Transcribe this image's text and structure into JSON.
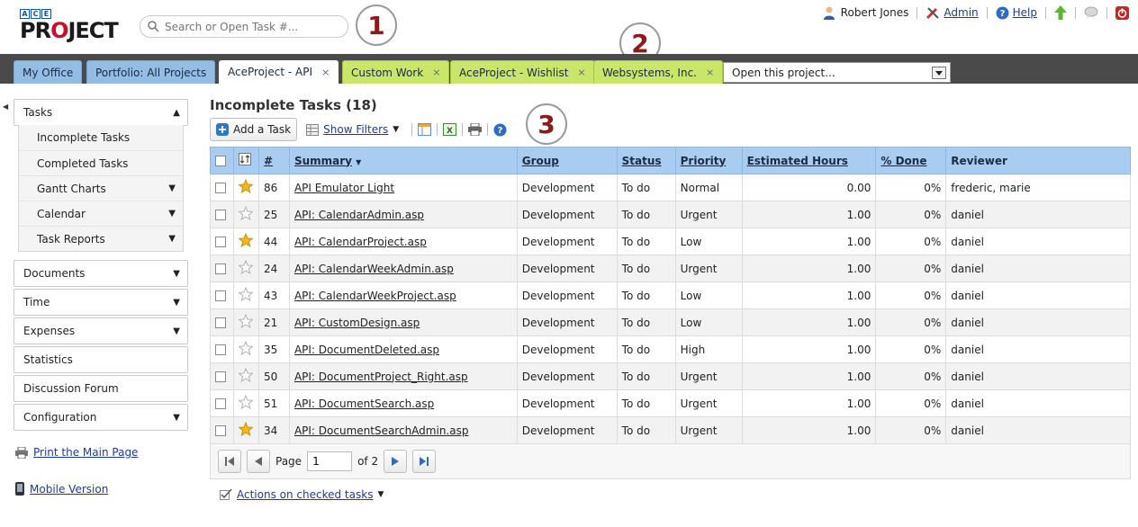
{
  "header": {
    "logo_top": "ACE",
    "logo_bottom": "PROJECT",
    "search_placeholder": "Search or Open Task #...",
    "user_name": "Robert Jones",
    "admin_label": "Admin",
    "help_label": "Help"
  },
  "callouts": [
    "1",
    "2",
    "3"
  ],
  "tabs": [
    {
      "label": "My Office",
      "style": "blue",
      "closable": false
    },
    {
      "label": "Portfolio: All Projects",
      "style": "blue",
      "closable": false
    },
    {
      "label": "AceProject - API",
      "style": "active",
      "closable": true
    },
    {
      "label": "Custom Work",
      "style": "green",
      "closable": true
    },
    {
      "label": "AceProject - Wishlist",
      "style": "green",
      "closable": true
    },
    {
      "label": "Websystems, Inc.",
      "style": "green",
      "closable": true
    }
  ],
  "tab_close_glyph": "×",
  "project_select": "Open this project...",
  "sidebar": {
    "tasks_label": "Tasks",
    "task_items": [
      {
        "label": "Incomplete Tasks",
        "expand": false
      },
      {
        "label": "Completed Tasks",
        "expand": false
      },
      {
        "label": "Gantt Charts",
        "expand": true
      },
      {
        "label": "Calendar",
        "expand": true
      },
      {
        "label": "Task Reports",
        "expand": true
      }
    ],
    "sections": [
      {
        "label": "Documents",
        "expand": true
      },
      {
        "label": "Time",
        "expand": true
      },
      {
        "label": "Expenses",
        "expand": true
      },
      {
        "label": "Statistics",
        "expand": false
      },
      {
        "label": "Discussion Forum",
        "expand": false
      },
      {
        "label": "Configuration",
        "expand": true
      }
    ],
    "print_link": "Print the Main Page",
    "mobile_link": "Mobile Version"
  },
  "main": {
    "title": "Incomplete Tasks (18)",
    "add_task": "Add a Task",
    "show_filters": "Show Filters",
    "columns": [
      "#",
      "Summary",
      "Group",
      "Status",
      "Priority",
      "Estimated Hours",
      "% Done",
      "Reviewer"
    ],
    "rows": [
      {
        "starred": true,
        "id": "86",
        "summary": "API Emulator Light",
        "group": "Development",
        "status": "To do",
        "priority": "Normal",
        "hours": "0.00",
        "done": "0%",
        "reviewer": "frederic, marie"
      },
      {
        "starred": false,
        "id": "25",
        "summary": "API: CalendarAdmin.asp",
        "group": "Development",
        "status": "To do",
        "priority": "Urgent",
        "hours": "1.00",
        "done": "0%",
        "reviewer": "daniel"
      },
      {
        "starred": true,
        "id": "44",
        "summary": "API: CalendarProject.asp",
        "group": "Development",
        "status": "To do",
        "priority": "Low",
        "hours": "1.00",
        "done": "0%",
        "reviewer": "daniel"
      },
      {
        "starred": false,
        "id": "24",
        "summary": "API: CalendarWeekAdmin.asp",
        "group": "Development",
        "status": "To do",
        "priority": "Urgent",
        "hours": "1.00",
        "done": "0%",
        "reviewer": "daniel"
      },
      {
        "starred": false,
        "id": "43",
        "summary": "API: CalendarWeekProject.asp",
        "group": "Development",
        "status": "To do",
        "priority": "Low",
        "hours": "1.00",
        "done": "0%",
        "reviewer": "daniel"
      },
      {
        "starred": false,
        "id": "21",
        "summary": "API: CustomDesign.asp",
        "group": "Development",
        "status": "To do",
        "priority": "Low",
        "hours": "1.00",
        "done": "0%",
        "reviewer": "daniel"
      },
      {
        "starred": false,
        "id": "35",
        "summary": "API: DocumentDeleted.asp",
        "group": "Development",
        "status": "To do",
        "priority": "High",
        "hours": "1.00",
        "done": "0%",
        "reviewer": "daniel"
      },
      {
        "starred": false,
        "id": "50",
        "summary": "API: DocumentProject_Right.asp",
        "group": "Development",
        "status": "To do",
        "priority": "Urgent",
        "hours": "1.00",
        "done": "0%",
        "reviewer": "daniel"
      },
      {
        "starred": false,
        "id": "51",
        "summary": "API: DocumentSearch.asp",
        "group": "Development",
        "status": "To do",
        "priority": "Urgent",
        "hours": "1.00",
        "done": "0%",
        "reviewer": "daniel"
      },
      {
        "starred": true,
        "id": "34",
        "summary": "API: DocumentSearchAdmin.asp",
        "group": "Development",
        "status": "To do",
        "priority": "Urgent",
        "hours": "1.00",
        "done": "0%",
        "reviewer": "daniel"
      }
    ],
    "pager": {
      "page_label": "Page",
      "page_value": "1",
      "of_label": "of 2"
    },
    "actions_label": "Actions on checked tasks"
  },
  "colors": {
    "tab_bar": "#4a4a4a",
    "tab_blue": "#94bde6",
    "tab_green": "#c9e66a",
    "header_row": "#a9cdf0",
    "callout_text": "#8b1a1a"
  }
}
